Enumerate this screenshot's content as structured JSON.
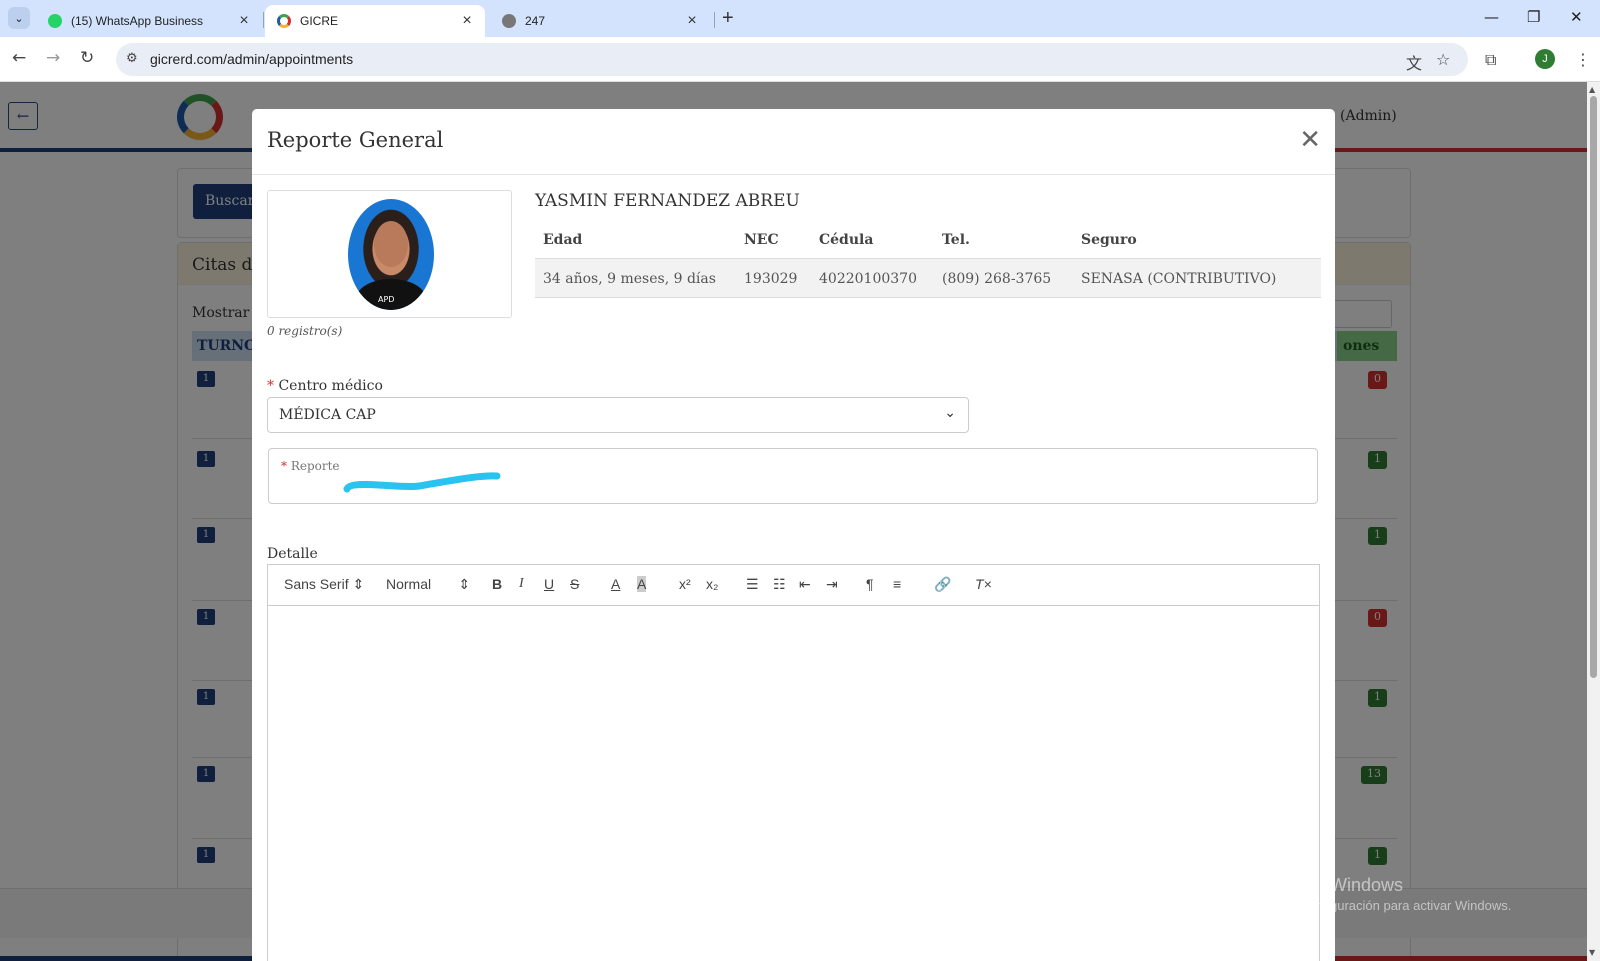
{
  "browser": {
    "tabs": [
      {
        "label": "(15) WhatsApp Business",
        "icon": "whatsapp-icon"
      },
      {
        "label": "GICRE",
        "icon": "gicre-logo-icon"
      },
      {
        "label": "247",
        "icon": "globe-icon"
      }
    ],
    "url": "gicrerd.com/admin/appointments",
    "profile_initial": "J"
  },
  "page": {
    "search_button": "Buscar",
    "admin_menu": "(Admin)",
    "list_title": "Citas de",
    "mostrar": "Mostrar",
    "table_head_first": "TURNO",
    "table_head_last": "ones",
    "rows": [
      {
        "turno": "1",
        "badge": "0",
        "color": "#d32f2f"
      },
      {
        "turno": "1",
        "badge": "1",
        "color": "#2e7d32"
      },
      {
        "turno": "1",
        "badge": "1",
        "color": "#2e7d32"
      },
      {
        "turno": "1",
        "badge": "0",
        "color": "#d32f2f"
      },
      {
        "turno": "1",
        "badge": "1",
        "color": "#2e7d32"
      },
      {
        "turno": "1",
        "badge": "13",
        "color": "#2e7d32"
      },
      {
        "turno": "1",
        "badge": "1",
        "color": "#2e7d32"
      }
    ]
  },
  "modal": {
    "title": "Reporte General",
    "photo_tag": "APD",
    "records": "0 registro(s)",
    "patient_name": "YASMIN FERNANDEZ ABREU",
    "info_headers": [
      "Edad",
      "NEC",
      "Cédula",
      "Tel.",
      "Seguro"
    ],
    "info_values": [
      "34 años, 9 meses, 9 días",
      "193029",
      "40220100370",
      "(809) 268-3765",
      "SENASA (CONTRIBUTIVO)"
    ],
    "centro_label": "Centro médico",
    "centro_value": "MÉDICA CAP",
    "reporte_label": "Reporte",
    "detalle_label": "Detalle",
    "editor": {
      "font": "Sans Serif",
      "size": "Normal"
    }
  },
  "watermark": {
    "line1": "Activar Windows",
    "line2": "Ve a Configuración para activar Windows."
  }
}
